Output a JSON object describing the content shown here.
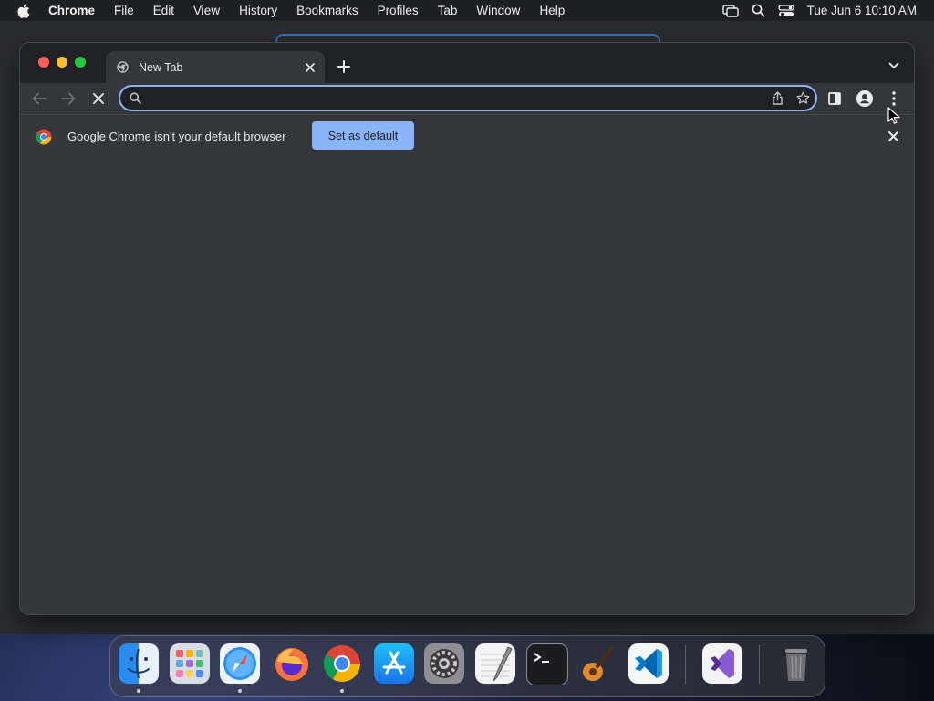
{
  "menubar": {
    "app_name": "Chrome",
    "items": [
      "File",
      "Edit",
      "View",
      "History",
      "Bookmarks",
      "Profiles",
      "Tab",
      "Window",
      "Help"
    ],
    "clock": "Tue Jun 6  10:10 AM"
  },
  "browser": {
    "tab_title": "New Tab",
    "omnibox_value": "",
    "infobar_message": "Google Chrome isn't your default browser",
    "infobar_button": "Set as default"
  },
  "dock": {
    "apps": [
      "Finder",
      "Launchpad",
      "Safari",
      "Firefox",
      "Google Chrome",
      "App Store",
      "System Settings",
      "TextEdit",
      "Terminal",
      "GarageBand",
      "Visual Studio Code",
      "Visual Studio",
      "Trash"
    ]
  },
  "colors": {
    "accent": "#8ab4f8",
    "window_bg": "#35363a",
    "tabstrip_bg": "#202124"
  }
}
